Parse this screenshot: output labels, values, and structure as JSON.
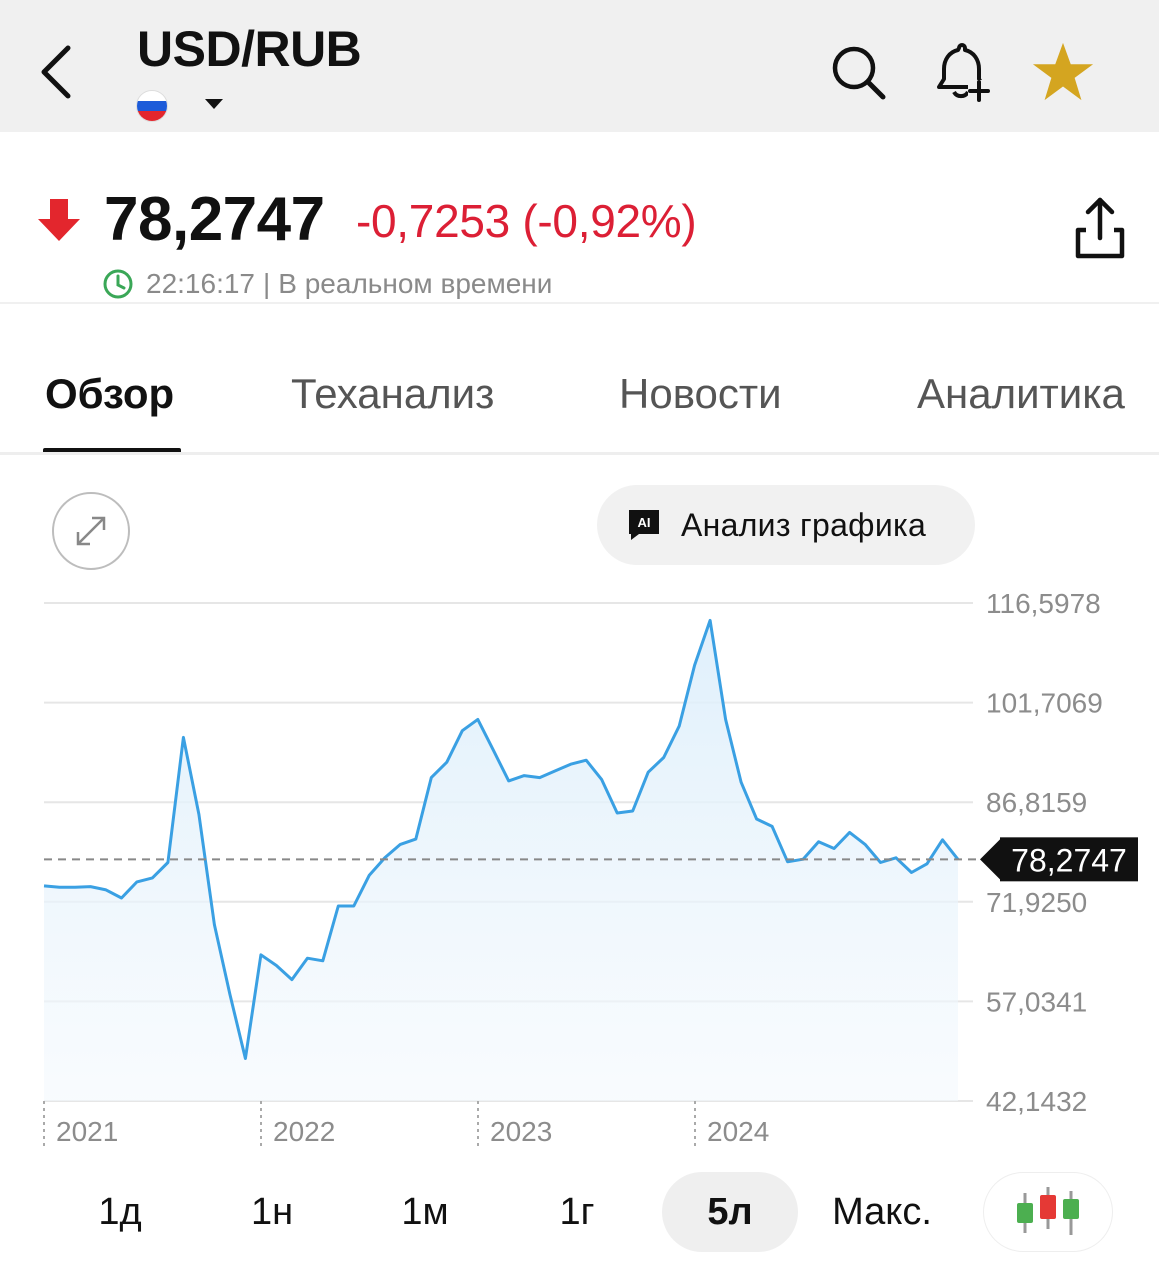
{
  "header": {
    "title": "USD/RUB",
    "flag_colors": [
      "#ffffff",
      "#1c5bd9",
      "#e3262d"
    ],
    "icons": [
      "back-chevron-icon",
      "search-icon",
      "bell-plus-icon",
      "star-icon"
    ],
    "star_color": "#d4a520"
  },
  "quote": {
    "price": "78,2747",
    "change": "-0,7253 (-0,92%)",
    "time": "22:16:17",
    "separator": "|",
    "realtime_label": "В реальном времени",
    "change_color": "#dc1f35",
    "clock_color": "#3aa757"
  },
  "tabs": [
    {
      "label": "Обзор",
      "active": true
    },
    {
      "label": "Теханализ",
      "active": false
    },
    {
      "label": "Новости",
      "active": false
    },
    {
      "label": "Аналитика",
      "active": false
    }
  ],
  "tools": {
    "ai_badge": "AI",
    "ai_label": "Анализ графика"
  },
  "chart_data": {
    "type": "area",
    "series": [
      {
        "values": [
          74.3,
          74.1,
          74.1,
          74.2,
          73.7,
          72.5,
          74.9,
          75.5,
          77.8,
          96.5,
          85,
          68.5,
          58.1,
          48.5,
          64,
          62.4,
          60.3,
          63.5,
          63.1,
          71.3,
          71.3,
          75.9,
          78.5,
          80.5,
          81.3,
          90.5,
          92.8,
          97.5,
          99.2,
          94.6,
          90,
          90.8,
          90.5,
          91.5,
          92.5,
          93.1,
          90.2,
          85.2,
          85.5,
          91.3,
          93.5,
          98.2,
          107.3,
          114,
          99.2,
          89.8,
          84.3,
          83.2,
          77.9,
          78.3,
          80.9,
          79.9,
          82.3,
          80.5,
          77.8,
          78.5,
          76.3,
          77.6,
          81.2,
          78.27
        ],
        "color": "#3aa0e3"
      }
    ],
    "x_ticks": [
      "2021",
      "2022",
      "2023",
      "2024"
    ],
    "y_ticks": [
      "116,5978",
      "101,7069",
      "86,8159",
      "71,9250",
      "57,0341",
      "42,1432"
    ],
    "ylim": [
      42.1432,
      116.5978
    ],
    "current_value": 78.2747,
    "current_label": "78,2747",
    "grid": true
  },
  "periods": [
    {
      "label": "1д",
      "active": false
    },
    {
      "label": "1н",
      "active": false
    },
    {
      "label": "1м",
      "active": false
    },
    {
      "label": "1г",
      "active": false
    },
    {
      "label": "5л",
      "active": true
    },
    {
      "label": "Макс.",
      "active": false
    }
  ],
  "candle_icon_colors": [
    "#4caf50",
    "#e53935",
    "#4caf50"
  ]
}
